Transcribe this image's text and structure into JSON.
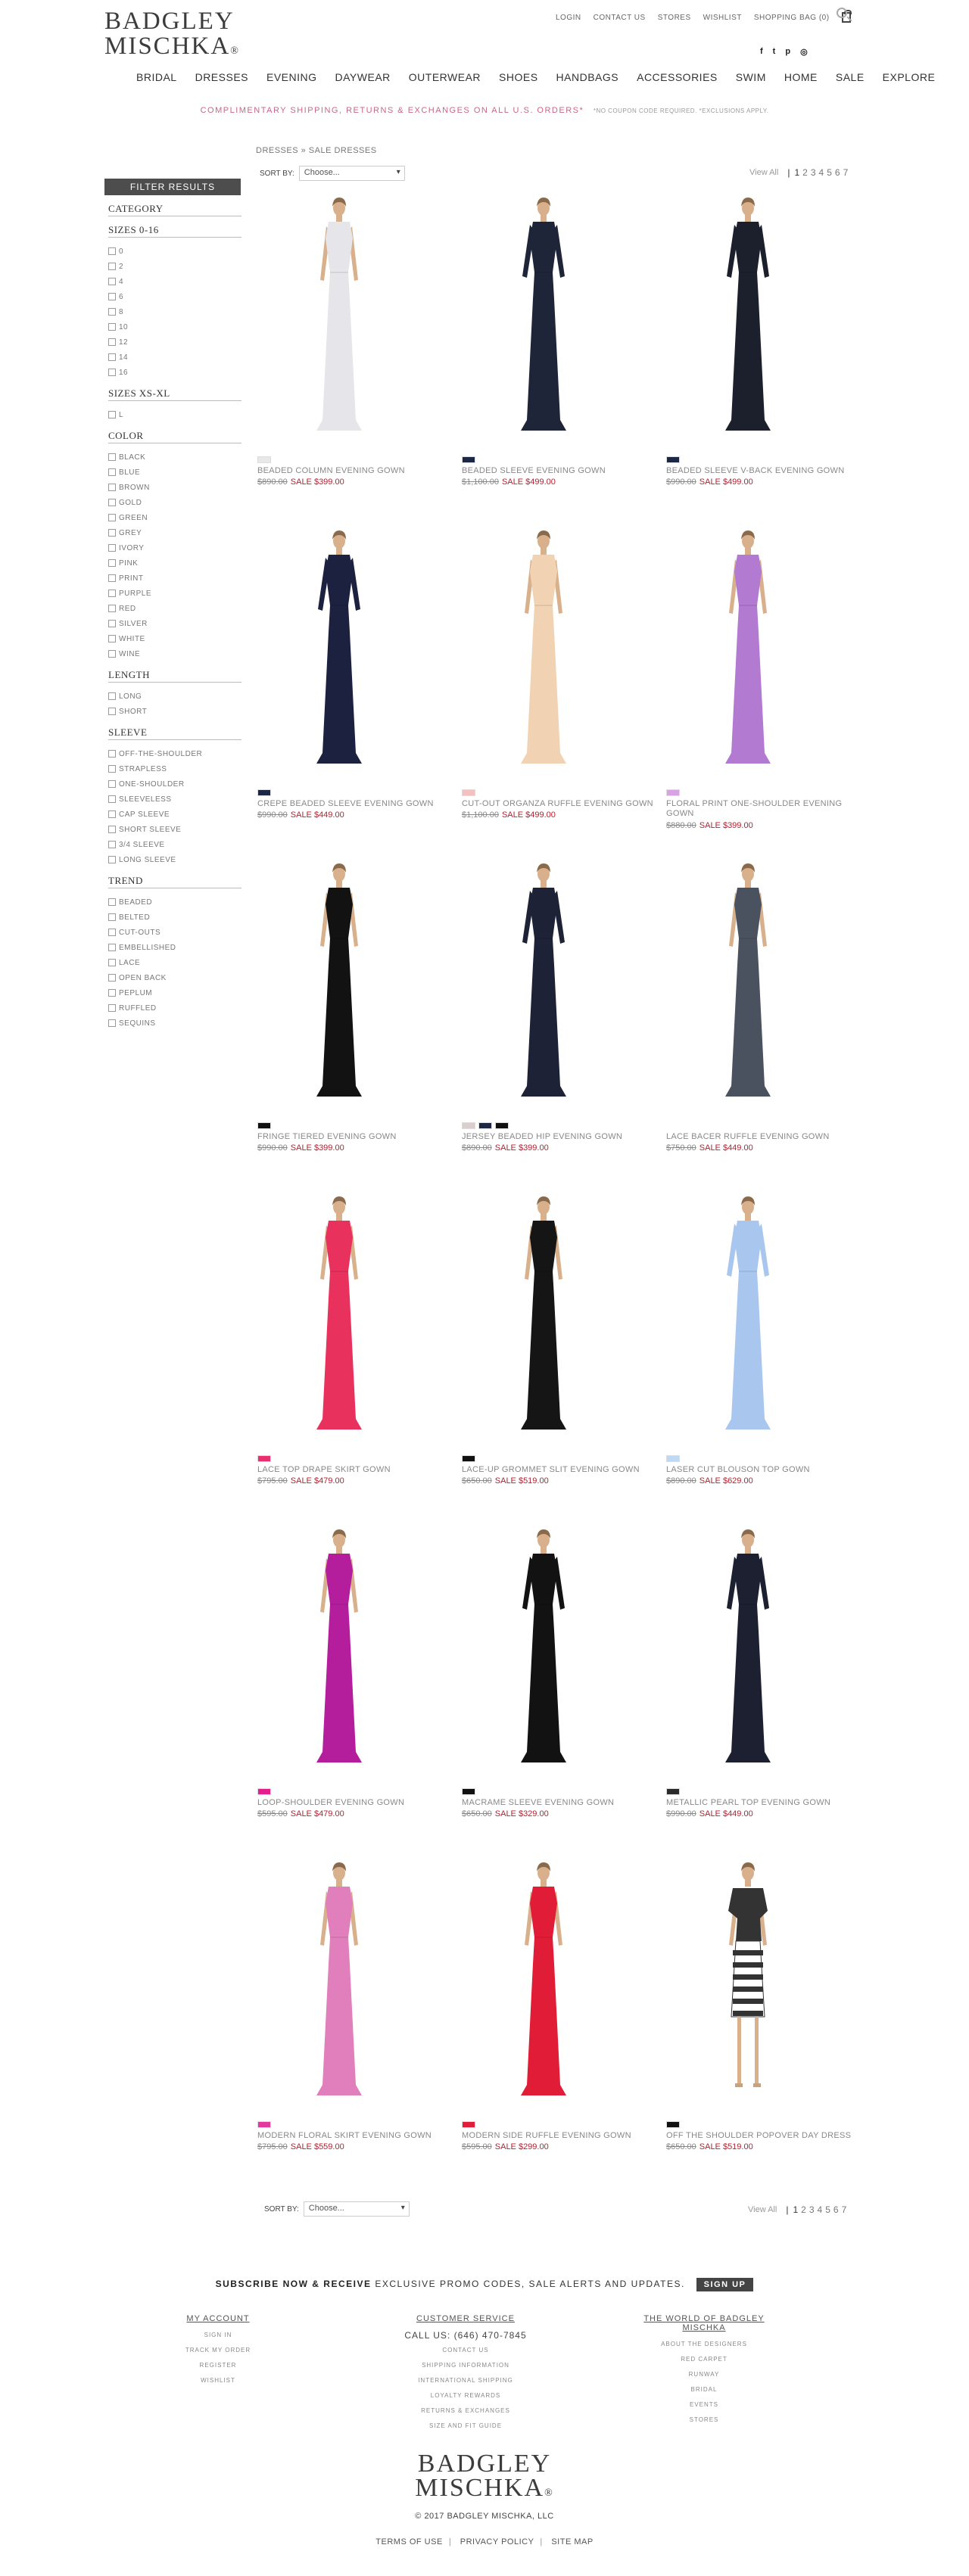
{
  "brand": {
    "line1": "BADGLEY",
    "line2": "MISCHKA",
    "mark": "®"
  },
  "util_nav": [
    "LOGIN",
    "CONTACT US",
    "STORES",
    "WISHLIST",
    "SHOPPING BAG (0)"
  ],
  "social": [
    "f",
    "t",
    "p",
    "ig"
  ],
  "main_nav": [
    "BRIDAL",
    "DRESSES",
    "EVENING",
    "DAYWEAR",
    "OUTERWEAR",
    "SHOES",
    "HANDBAGS",
    "ACCESSORIES",
    "SWIM",
    "HOME",
    "SALE",
    "EXPLORE"
  ],
  "promo": {
    "text": "COMPLIMENTARY SHIPPING, RETURNS & EXCHANGES ON ALL U.S. ORDERS*",
    "note": "*NO COUPON CODE REQUIRED. *EXCLUSIONS APPLY."
  },
  "breadcrumb": "DRESSES » SALE DRESSES",
  "sort": {
    "label": "SORT BY:",
    "value": "Choose..."
  },
  "pager": {
    "view_all": "View All",
    "pages": [
      "1",
      "2",
      "3",
      "4",
      "5",
      "6",
      "7"
    ],
    "current": "1"
  },
  "sidebar": {
    "header": "FILTER RESULTS",
    "facets": [
      {
        "title": "CATEGORY",
        "options": []
      },
      {
        "title": "SIZES 0-16",
        "options": [
          "0",
          "2",
          "4",
          "6",
          "8",
          "10",
          "12",
          "14",
          "16"
        ]
      },
      {
        "title": "SIZES XS-XL",
        "options": [
          "L"
        ]
      },
      {
        "title": "COLOR",
        "options": [
          "BLACK",
          "BLUE",
          "BROWN",
          "GOLD",
          "GREEN",
          "GREY",
          "IVORY",
          "PINK",
          "PRINT",
          "PURPLE",
          "RED",
          "SILVER",
          "WHITE",
          "WINE"
        ]
      },
      {
        "title": "LENGTH",
        "options": [
          "LONG",
          "SHORT"
        ]
      },
      {
        "title": "SLEEVE",
        "options": [
          "OFF-THE-SHOULDER",
          "STRAPLESS",
          "ONE-SHOULDER",
          "SLEEVELESS",
          "CAP SLEEVE",
          "SHORT SLEEVE",
          "3/4 SLEEVE",
          "LONG SLEEVE"
        ]
      },
      {
        "title": "TREND",
        "options": [
          "BEADED",
          "BELTED",
          "CUT-OUTS",
          "EMBELLISHED",
          "LACE",
          "OPEN BACK",
          "PEPLUM",
          "RUFFLED",
          "SEQUINS"
        ]
      }
    ]
  },
  "products": [
    {
      "name": "BEADED COLUMN EVENING GOWN",
      "orig": "$890.00",
      "sale": "SALE $399.00",
      "swatches": [
        "#e8e8e8"
      ],
      "fill": "#e6e6ea",
      "style": "column",
      "wrap": false
    },
    {
      "name": "BEADED SLEEVE EVENING GOWN",
      "orig": "$1,100.00",
      "sale": "SALE $499.00",
      "swatches": [
        "#1c2744"
      ],
      "fill": "#1f2538",
      "style": "sleeve",
      "wrap": false
    },
    {
      "name": "BEADED SLEEVE V-BACK EVENING GOWN",
      "orig": "$990.00",
      "sale": "SALE $499.00",
      "swatches": [
        "#1c2744"
      ],
      "fill": "#1c1f2c",
      "style": "sleeve",
      "wrap": false
    },
    {
      "name": "CREPE BEADED SLEEVE EVENING GOWN",
      "orig": "$990.00",
      "sale": "SALE $449.00",
      "swatches": [
        "#1c2744"
      ],
      "fill": "#1c2140",
      "style": "long",
      "wrap": false
    },
    {
      "name": "CUT-OUT ORGANZA RUFFLE EVENING GOWN",
      "orig": "$1,100.00",
      "sale": "SALE $499.00",
      "swatches": [
        "#f3c2bf"
      ],
      "fill": "#f1d3b4",
      "style": "column",
      "wrap": false
    },
    {
      "name": "FLORAL PRINT ONE-SHOULDER EVENING GOWN",
      "orig": "$880.00",
      "sale": "SALE $399.00",
      "swatches": [
        "#d8a3e3"
      ],
      "fill": "#b27ad1",
      "style": "column",
      "wrap": true
    },
    {
      "name": "FRINGE TIERED EVENING GOWN",
      "orig": "$990.00",
      "sale": "SALE $399.00",
      "swatches": [
        "#111111"
      ],
      "fill": "#121212",
      "style": "column",
      "wrap": false
    },
    {
      "name": "JERSEY BEADED HIP EVENING GOWN",
      "orig": "$890.00",
      "sale": "SALE $399.00",
      "swatches": [
        "#d9cfcf",
        "#1c2744",
        "#111111"
      ],
      "fill": "#1e2236",
      "style": "long",
      "wrap": false
    },
    {
      "name": "LACE BACER RUFFLE EVENING GOWN",
      "orig": "$750.00",
      "sale": "SALE $449.00",
      "swatches": [],
      "fill": "#4a5260",
      "style": "column",
      "wrap": false
    },
    {
      "name": "LACE TOP DRAPE SKIRT GOWN",
      "orig": "$795.00",
      "sale": "SALE $479.00",
      "swatches": [
        "#e9306e"
      ],
      "fill": "#e8315d",
      "style": "column",
      "wrap": false
    },
    {
      "name": "LACE-UP GROMMET SLIT EVENING GOWN",
      "orig": "$650.00",
      "sale": "SALE $519.00",
      "swatches": [
        "#111111"
      ],
      "fill": "#151515",
      "style": "column",
      "wrap": false
    },
    {
      "name": "LASER CUT BLOUSON TOP GOWN",
      "orig": "$890.00",
      "sale": "SALE $629.00",
      "swatches": [
        "#bfd8f3"
      ],
      "fill": "#a9c7ee",
      "style": "sleeve",
      "wrap": false
    },
    {
      "name": "LOOP-SHOULDER EVENING GOWN",
      "orig": "$595.00",
      "sale": "SALE $479.00",
      "swatches": [
        "#e21f8d"
      ],
      "fill": "#b41e9c",
      "style": "column",
      "wrap": false
    },
    {
      "name": "MACRAME SLEEVE EVENING GOWN",
      "orig": "$650.00",
      "sale": "SALE $329.00",
      "swatches": [
        "#111111"
      ],
      "fill": "#121212",
      "style": "sleeve",
      "wrap": false
    },
    {
      "name": "METALLIC PEARL TOP EVENING GOWN",
      "orig": "$990.00",
      "sale": "SALE $449.00",
      "swatches": [
        "#2a2a2a"
      ],
      "fill": "#1c2030",
      "style": "sleeve",
      "wrap": false
    },
    {
      "name": "MODERN FLORAL SKIRT EVENING GOWN",
      "orig": "$795.00",
      "sale": "SALE $559.00",
      "swatches": [
        "#e03a9a"
      ],
      "fill": "#e07fbb",
      "style": "column",
      "wrap": false
    },
    {
      "name": "MODERN SIDE RUFFLE EVENING GOWN",
      "orig": "$595.00",
      "sale": "SALE $299.00",
      "swatches": [
        "#e01e3c"
      ],
      "fill": "#e11c36",
      "style": "column",
      "wrap": false
    },
    {
      "name": "OFF THE SHOULDER POPOVER DAY DRESS",
      "orig": "$650.00",
      "sale": "SALE $519.00",
      "swatches": [
        "#111111"
      ],
      "fill": "#333333",
      "style": "short",
      "wrap": false
    }
  ],
  "newsletter": {
    "bold": "SUBSCRIBE NOW & RECEIVE",
    "rest": "EXCLUSIVE PROMO CODES, SALE ALERTS AND UPDATES.",
    "button": "SIGN UP"
  },
  "footer": {
    "account": {
      "title": "MY ACCOUNT",
      "items": [
        "SIGN IN",
        "TRACK MY ORDER",
        "REGISTER",
        "WISHLIST"
      ]
    },
    "service": {
      "title": "CUSTOMER SERVICE",
      "phone": "CALL US: (646) 470-7845",
      "items": [
        "CONTACT US",
        "SHIPPING INFORMATION",
        "INTERNATIONAL SHIPPING",
        "LOYALTY REWARDS",
        "RETURNS & EXCHANGES",
        "SIZE AND FIT GUIDE"
      ]
    },
    "world": {
      "title": "THE WORLD OF BADGLEY MISCHKA",
      "items": [
        "ABOUT THE DESIGNERS",
        "RED CARPET",
        "RUNWAY",
        "BRIDAL",
        "EVENTS",
        "STORES"
      ]
    },
    "logo_line1": "BADGLEY",
    "logo_line2": "MISCHKA",
    "copyright": "© 2017 BADGLEY MISCHKA, LLC",
    "legal": [
      "TERMS OF USE",
      "PRIVACY POLICY",
      "SITE MAP"
    ]
  }
}
